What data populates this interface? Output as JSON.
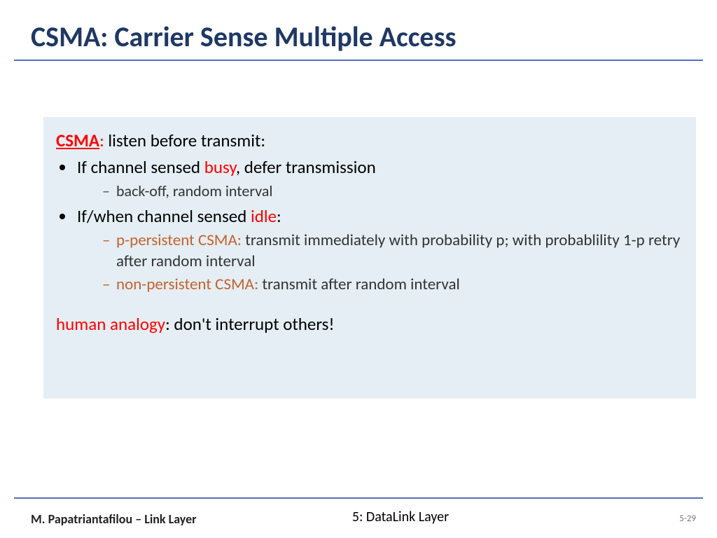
{
  "title": "CSMA: Carrier Sense Multiple Access",
  "lead": {
    "csma_label": "CSMA",
    "colon": ":",
    "tail": " listen before transmit:"
  },
  "bullets": {
    "busy": {
      "pre": "If channel sensed ",
      "key": "busy",
      "post": ", defer transmission",
      "sub": "back-off, random interval"
    },
    "idle": {
      "pre": "If/when channel sensed ",
      "key": "idle",
      "post": ":",
      "sub1": {
        "label": "p-persistent CSMA:",
        "text": " transmit immediately with probability p; with probablility 1-p retry after random interval"
      },
      "sub2": {
        "label": "non-persistent CSMA:",
        "text": " transmit after random interval"
      }
    }
  },
  "analogy": {
    "label": "human analogy",
    "text": ": don't interrupt others!"
  },
  "footer": {
    "left": "M. Papatriantafilou –  Link Layer",
    "center": "5: DataLink Layer",
    "right": "5-29"
  }
}
